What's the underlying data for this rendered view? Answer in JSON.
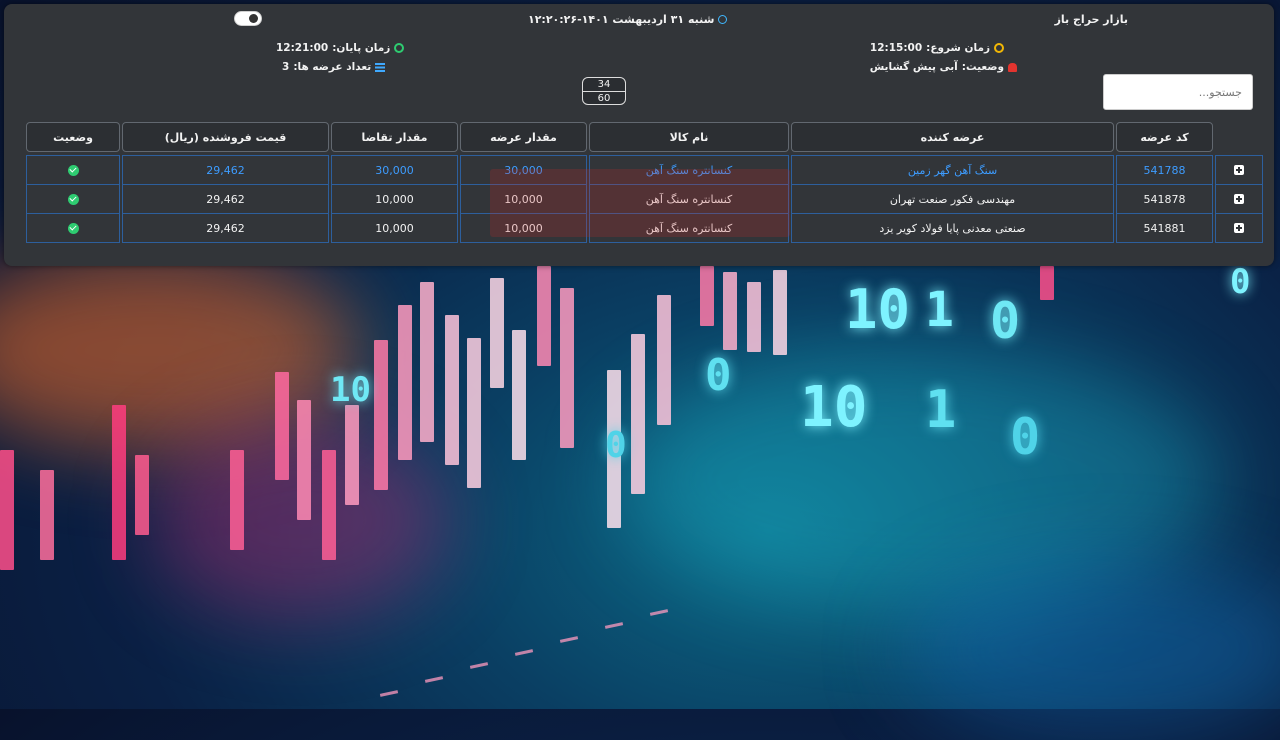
{
  "header": {
    "market_title": "بازار حراج باز",
    "datetime": "شنبه ۳۱ اردیبهشت ۱۴۰۱-۱۲:۲۰:۲۶",
    "start_time_label": "زمان شروع:",
    "start_time_value": "12:15:00",
    "status_label": "وضعیت:",
    "status_value": "آبی پیش گشایش",
    "end_time_label": "زمان پایان:",
    "end_time_value": "12:21:00",
    "offer_count_label": "تعداد عرضه ها:",
    "offer_count_value": "3",
    "counter_top": "34",
    "counter_bottom": "60"
  },
  "search": {
    "placeholder": "جستجو..."
  },
  "table": {
    "headers": [
      "کد عرضه",
      "عرضه کننده",
      "نام کالا",
      "مقدار عرضه",
      "مقدار تقاضا",
      "قیمت فروشنده (ریال)",
      "وضعیت"
    ],
    "rows": [
      {
        "code": "541788",
        "supplier": "سنگ آهن گهر زمین",
        "product": "کنسانتره سنگ آهن",
        "supply": "30,000",
        "demand": "30,000",
        "price": "29,462",
        "highlight": true
      },
      {
        "code": "541878",
        "supplier": "مهندسی فکور صنعت تهران",
        "product": "کنسانتره سنگ آهن",
        "supply": "10,000",
        "demand": "10,000",
        "price": "29,462",
        "highlight": false
      },
      {
        "code": "541881",
        "supplier": "صنعتی معدنی پایا فولاد کویر یزد",
        "product": "کنسانتره سنگ آهن",
        "supply": "10,000",
        "demand": "10,000",
        "price": "29,462",
        "highlight": false
      }
    ]
  },
  "icons": {
    "start_time": "clock-icon",
    "status": "bell-icon",
    "end_time": "clock-icon",
    "offer_count": "list-icon",
    "datetime": "clock-icon",
    "row_expand": "plus-square-icon",
    "row_status": "check-circle-icon"
  },
  "background_digits": [
    "10",
    "1",
    "0",
    "10",
    "1",
    "0",
    "0",
    "10",
    "0",
    "0"
  ],
  "colors": {
    "link": "#3d9cff",
    "ok": "#2ecc71",
    "panel": "#323539",
    "row_border": "#2d5f9d"
  }
}
